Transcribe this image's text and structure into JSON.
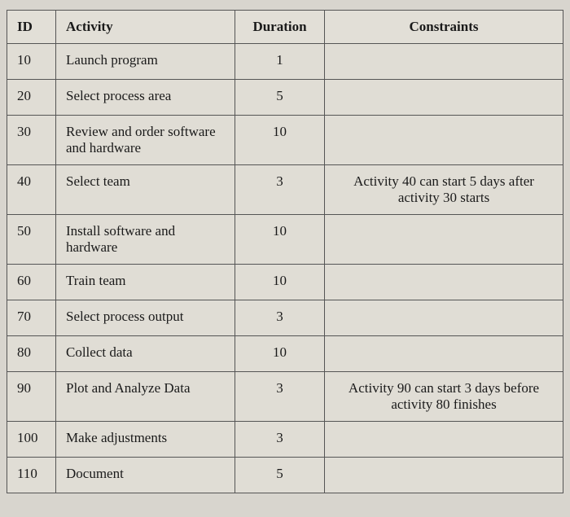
{
  "table": {
    "headers": {
      "id": "ID",
      "activity": "Activity",
      "duration": "Duration",
      "constraints": "Constraints"
    },
    "rows": [
      {
        "id": "10",
        "activity": "Launch program",
        "duration": "1",
        "constraints": ""
      },
      {
        "id": "20",
        "activity": "Select process area",
        "duration": "5",
        "constraints": ""
      },
      {
        "id": "30",
        "activity": "Review and order software and hardware",
        "duration": "10",
        "constraints": ""
      },
      {
        "id": "40",
        "activity": "Select team",
        "duration": "3",
        "constraints": "Activity 40 can start 5 days after activity 30 starts"
      },
      {
        "id": "50",
        "activity": "Install software and hardware",
        "duration": "10",
        "constraints": ""
      },
      {
        "id": "60",
        "activity": "Train team",
        "duration": "10",
        "constraints": ""
      },
      {
        "id": "70",
        "activity": "Select process output",
        "duration": "3",
        "constraints": ""
      },
      {
        "id": "80",
        "activity": "Collect data",
        "duration": "10",
        "constraints": ""
      },
      {
        "id": "90",
        "activity": "Plot and Analyze Data",
        "duration": "3",
        "constraints": "Activity 90 can start 3 days before activity 80 finishes"
      },
      {
        "id": "100",
        "activity": "Make adjustments",
        "duration": "3",
        "constraints": ""
      },
      {
        "id": "110",
        "activity": "Document",
        "duration": "5",
        "constraints": ""
      }
    ]
  }
}
